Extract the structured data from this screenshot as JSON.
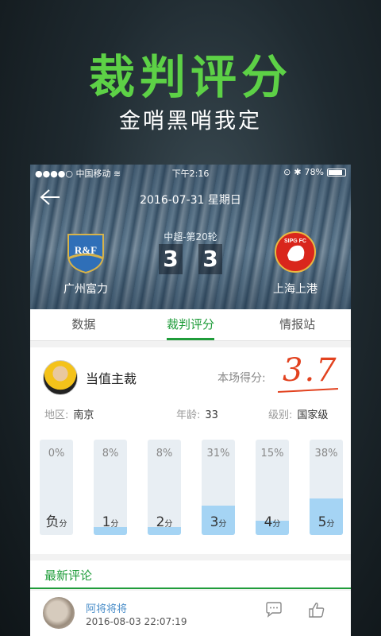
{
  "promo": {
    "title": "裁判评分",
    "subtitle": "金哨黑哨我定"
  },
  "status_bar": {
    "signal": "●●●●○",
    "carrier": "中国移动",
    "time": "下午2:16",
    "battery": "78%"
  },
  "match": {
    "date": "2016-07-31 星期日",
    "league": "中超-第20轮",
    "home": {
      "name": "广州富力",
      "score": "3",
      "logo_text": "R&F"
    },
    "away": {
      "name": "上海上港",
      "score": "3",
      "logo_text": "SIPG FC"
    }
  },
  "tabs": [
    {
      "label": "数据",
      "active": false
    },
    {
      "label": "裁判评分",
      "active": true
    },
    {
      "label": "情报站",
      "active": false
    }
  ],
  "referee": {
    "role": "当值主裁",
    "score_label": "本场得分:",
    "score": "3.7",
    "region_label": "地区:",
    "region": "南京",
    "age_label": "年龄:",
    "age": "33",
    "level_label": "级别:",
    "level": "国家级"
  },
  "rating_distribution": [
    {
      "pct": "0%",
      "value": 0,
      "label": "负",
      "unit": "分"
    },
    {
      "pct": "8%",
      "value": 8,
      "label": "1",
      "unit": "分"
    },
    {
      "pct": "8%",
      "value": 8,
      "label": "2",
      "unit": "分"
    },
    {
      "pct": "31%",
      "value": 31,
      "label": "3",
      "unit": "分"
    },
    {
      "pct": "15%",
      "value": 15,
      "label": "4",
      "unit": "分"
    },
    {
      "pct": "38%",
      "value": 38,
      "label": "5",
      "unit": "分"
    }
  ],
  "comments": {
    "header": "最新评论",
    "items": [
      {
        "name": "阿将将将",
        "time": "2016-08-03 22:07:19"
      }
    ]
  },
  "colors": {
    "accent": "#1f9c3a",
    "promo_green": "#5dd146",
    "score_red": "#e2421f",
    "bar_fill": "#a5d4f4"
  }
}
